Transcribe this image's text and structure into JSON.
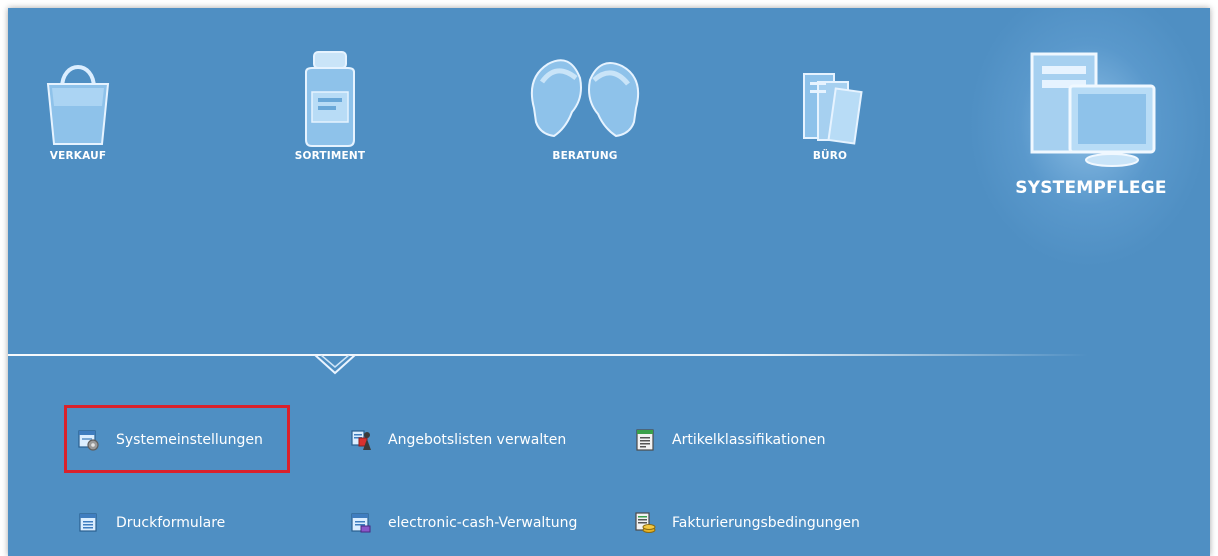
{
  "nav": {
    "items": [
      {
        "label": "VERKAUF",
        "icon": "shopping-bag-icon"
      },
      {
        "label": "SORTIMENT",
        "icon": "medicine-bottle-icon"
      },
      {
        "label": "BERATUNG",
        "icon": "consultation-heads-icon"
      },
      {
        "label": "BÜRO",
        "icon": "documents-icon"
      },
      {
        "label": "SYSTEMPFLEGE",
        "icon": "computer-system-icon",
        "active": true
      }
    ]
  },
  "functions": {
    "items": [
      {
        "label": "Systemeinstellungen",
        "icon": "system-settings-icon",
        "highlighted": true
      },
      {
        "label": "Angebotslisten verwalten",
        "icon": "offer-lists-icon"
      },
      {
        "label": "Artikelklassifikationen",
        "icon": "article-classification-icon"
      },
      {
        "label": "Druckformulare",
        "icon": "print-forms-icon"
      },
      {
        "label": "electronic-cash-Verwaltung",
        "icon": "electronic-cash-icon"
      },
      {
        "label": "Fakturierungsbedingungen",
        "icon": "billing-conditions-icon"
      }
    ]
  },
  "colors": {
    "background": "#4f8fc3",
    "highlight_border": "#d9212c",
    "text": "#ffffff"
  }
}
